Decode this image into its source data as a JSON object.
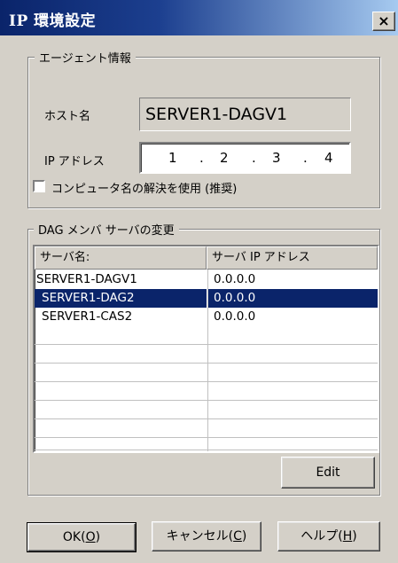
{
  "window": {
    "title": "IP 環境設定",
    "close_glyph": "×"
  },
  "agent_group": {
    "label": "エージェント情報",
    "host_label": "ホスト名",
    "host_value": "SERVER1-DAGV1",
    "ip_label": "IP アドレス",
    "ip_octets": [
      "1",
      "2",
      "3",
      "4"
    ],
    "ip_dot": ".",
    "checkbox_label": "コンピュータ名の解決を使用 (推奨)",
    "checkbox_checked": false
  },
  "dag_group": {
    "label": "DAG メンバ サーバの変更",
    "columns": [
      "サーバ名:",
      "サーバ IP アドレス"
    ],
    "rows": [
      {
        "name": "SERVER1-DAGV1",
        "ip": "0.0.0.0",
        "selected": false
      },
      {
        "name": "SERVER1-DAG2",
        "ip": "0.0.0.0",
        "selected": true
      },
      {
        "name": "SERVER1-CAS2",
        "ip": "0.0.0.0",
        "selected": false
      }
    ],
    "edit_label": "Edit"
  },
  "buttons": {
    "ok": {
      "text": "OK(",
      "key": "O",
      "end": ")"
    },
    "cancel": {
      "text": "キャンセル(",
      "key": "C",
      "end": ")"
    },
    "help": {
      "text": "ヘルプ(",
      "key": "H",
      "end": ")"
    }
  }
}
